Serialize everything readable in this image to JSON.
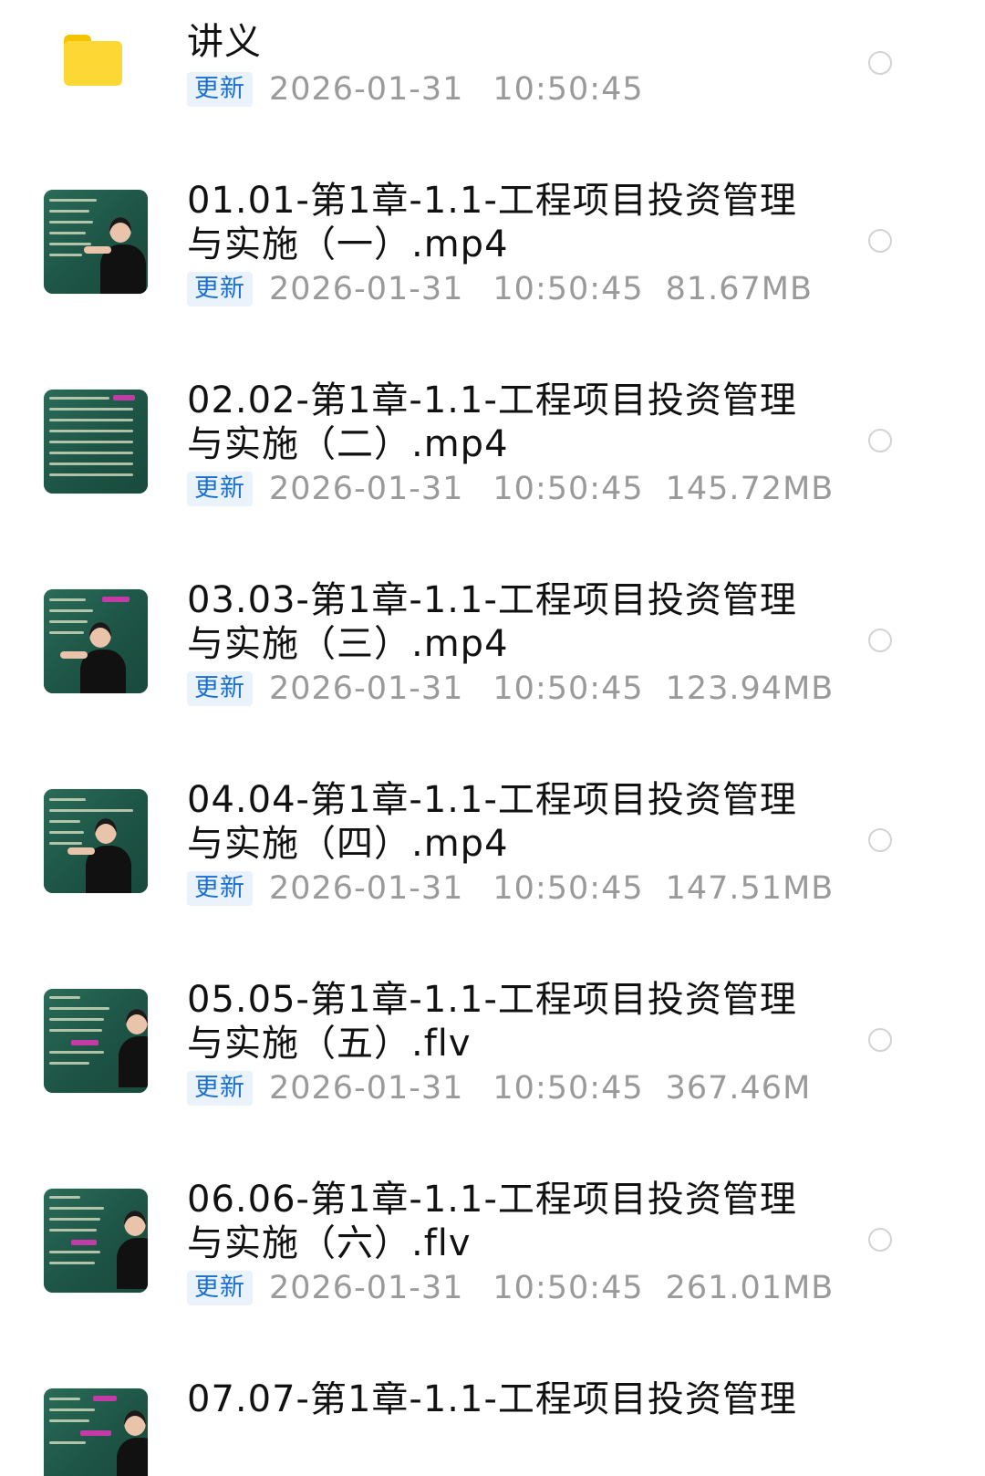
{
  "items": [
    {
      "type": "folder",
      "title_line1": "讲义",
      "title_line2": "",
      "badge": "更新",
      "date": "2026-01-31",
      "time": "10:50:45",
      "size": ""
    },
    {
      "type": "video",
      "title_line1": "01.01-第1章-1.1-工程项目投资管理",
      "title_line2": "与实施（一）.mp4",
      "badge": "更新",
      "date": "2026-01-31",
      "time": "10:50:45",
      "size": "81.67MB"
    },
    {
      "type": "video",
      "title_line1": "02.02-第1章-1.1-工程项目投资管理",
      "title_line2": "与实施（二）.mp4",
      "badge": "更新",
      "date": "2026-01-31",
      "time": "10:50:45",
      "size": "145.72MB"
    },
    {
      "type": "video",
      "title_line1": "03.03-第1章-1.1-工程项目投资管理",
      "title_line2": "与实施（三）.mp4",
      "badge": "更新",
      "date": "2026-01-31",
      "time": "10:50:45",
      "size": "123.94MB"
    },
    {
      "type": "video",
      "title_line1": "04.04-第1章-1.1-工程项目投资管理",
      "title_line2": "与实施（四）.mp4",
      "badge": "更新",
      "date": "2026-01-31",
      "time": "10:50:45",
      "size": "147.51MB"
    },
    {
      "type": "video",
      "title_line1": "05.05-第1章-1.1-工程项目投资管理",
      "title_line2": "与实施（五）.flv",
      "badge": "更新",
      "date": "2026-01-31",
      "time": "10:50:45",
      "size": "367.46M"
    },
    {
      "type": "video",
      "title_line1": "06.06-第1章-1.1-工程项目投资管理",
      "title_line2": "与实施（六）.flv",
      "badge": "更新",
      "date": "2026-01-31",
      "time": "10:50:45",
      "size": "261.01MB"
    },
    {
      "type": "video",
      "title_line1": "07.07-第1章-1.1-工程项目投资管理",
      "title_line2": "",
      "badge": "",
      "date": "",
      "time": "",
      "size": ""
    }
  ],
  "icons": {
    "folder": "folder-icon",
    "video": "video-thumbnail",
    "select": "select-radio-icon"
  },
  "colors": {
    "folder": "#fdd835",
    "badge_text": "#1a6fd1",
    "badge_bg": "#eaf3fb",
    "meta_text": "#9a9a9a"
  }
}
